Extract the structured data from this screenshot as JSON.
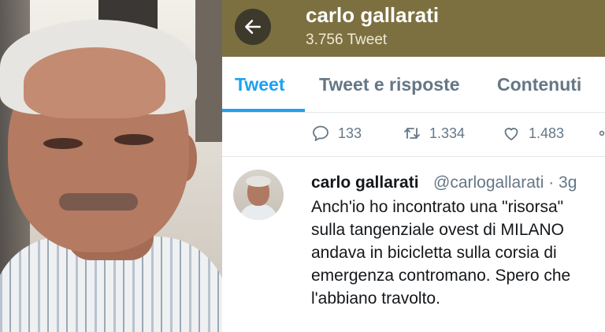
{
  "header": {
    "name": "carlo gallarati",
    "tweet_count": "3.756 Tweet",
    "color": "#7d7040"
  },
  "tabs": [
    {
      "label": "Tweet",
      "active": true
    },
    {
      "label": "Tweet e risposte",
      "active": false
    },
    {
      "label": "Contenuti",
      "active": false
    }
  ],
  "actions": {
    "reply_count": "133",
    "retweet_count": "1.334",
    "like_count": "1.483"
  },
  "tweet": {
    "name": "carlo gallarati",
    "handle": "@carlogallarati · 3g",
    "lines": [
      "Anch'io ho incontrato una \"risorsa\"",
      "sulla tangenziale ovest di MILANO",
      "andava in bicicletta sulla corsia di",
      "emergenza contromano. Spero che",
      "l'abbiano travolto."
    ]
  },
  "icons": {
    "back": "arrow-left-icon",
    "reply": "reply-icon",
    "retweet": "retweet-icon",
    "like": "heart-icon",
    "more": "more-icon"
  },
  "colors": {
    "accent": "#1da1f2",
    "muted": "#657786"
  }
}
